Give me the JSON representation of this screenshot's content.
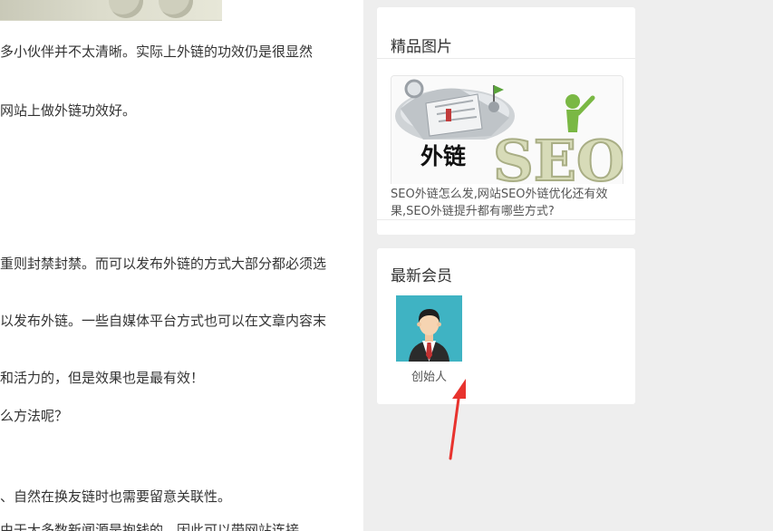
{
  "article": {
    "lines": [
      "多小伙伴并不太清晰。实际上外链的功效仍是很显然",
      "网站上做外链功效好。",
      "重则封禁封禁。而可以发布外链的方式大部分都必须选",
      "以发布外链。一些自媒体平台方式也可以在文章内容末",
      "和活力的，但是效果也是最有效！",
      "么方法呢？",
      "、自然在换友链时也需要留意关联性。",
      "由于大多数新闻源是抱钱的，因此可以带网站连接"
    ]
  },
  "sidebar": {
    "featured": {
      "title": "精品图片",
      "image_text": {
        "chinese": "外链",
        "latin": "SEO"
      },
      "caption": "SEO外链怎么发,网站SEO外链优化还有效果,SEO外链提升都有哪些方式?"
    },
    "members": {
      "title": "最新会员",
      "items": [
        {
          "name": "创始人",
          "avatar": "avatar-businessman-icon"
        }
      ]
    }
  },
  "colors": {
    "page_bg": "#eeeeee",
    "card_bg": "#ffffff",
    "avatar_bg": "#3fb3c3",
    "annotation_arrow": "#e8332e"
  }
}
